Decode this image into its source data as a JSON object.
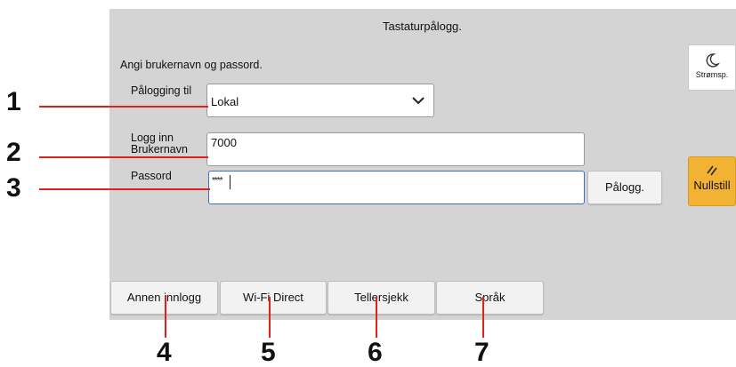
{
  "header": {
    "title": "Tastaturpålogg."
  },
  "instruction": "Angi brukernavn og passord.",
  "login_to": {
    "label": "Pålogging til",
    "value": "Lokal"
  },
  "username": {
    "label": "Logg inn Brukernavn",
    "value": "7000"
  },
  "password": {
    "label": "Passord",
    "value": "****"
  },
  "login_button": "Pålogg.",
  "side": {
    "energy_label": "Strømsp.",
    "reset_label": "Nullstill"
  },
  "bottom_buttons": [
    {
      "label": "Annen innlogg"
    },
    {
      "label": "Wi-Fi Direct"
    },
    {
      "label": "Tellersjekk"
    },
    {
      "label": "Språk"
    }
  ],
  "callouts": [
    "1",
    "2",
    "3",
    "4",
    "5",
    "6",
    "7"
  ],
  "colors": {
    "callout": "#e0211b",
    "reset": "#f2b233",
    "panel": "#d4d4d4"
  }
}
